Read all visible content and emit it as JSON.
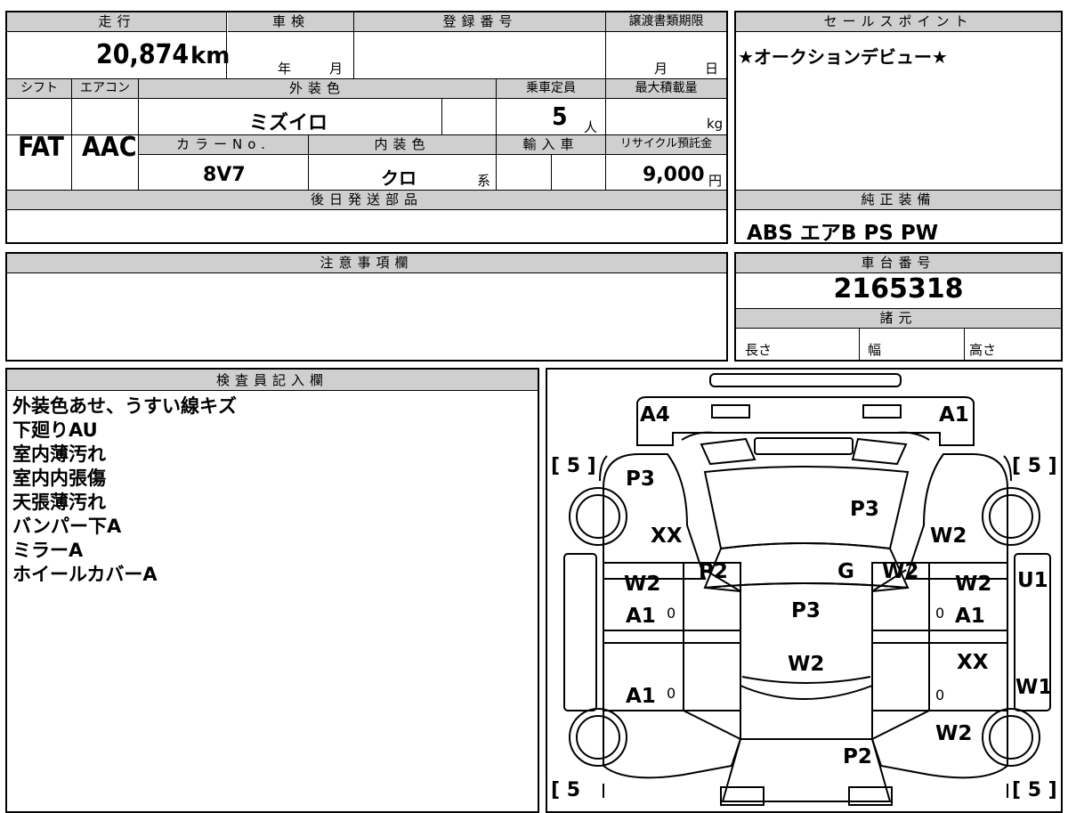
{
  "top_info": {
    "headers": {
      "mileage": "走行",
      "inspection": "車検",
      "registration_no": "登録番号",
      "transfer_deadline": "譲渡書類期限",
      "shift": "シフト",
      "aircon": "エアコン",
      "exterior_color": "外装色",
      "capacity": "乗車定員",
      "max_load": "最大積載量",
      "color_no": "カラーNo.",
      "interior_color": "内装色",
      "import": "輸入車",
      "recycle_fee": "リサイクル預託金",
      "later_parts": "後日発送部品"
    },
    "mileage_value": "20,874",
    "mileage_unit": "km",
    "inspection_year_unit": "年",
    "inspection_month_unit": "月",
    "transfer_month_unit": "月",
    "transfer_day_unit": "日",
    "shift_value": "FAT",
    "aircon_value": "AAC",
    "exterior_color_value": "ミズイロ",
    "capacity_value": "5",
    "capacity_unit": "人",
    "max_load_unit": "kg",
    "color_no_value": "8V7",
    "interior_color_value": "クロ",
    "interior_color_suffix": "系",
    "recycle_fee_value": "9,000",
    "recycle_fee_unit": "円"
  },
  "sales_point": {
    "header": "セールスポイント",
    "text": "★オークションデビュー★"
  },
  "equipment": {
    "header": "純正装備",
    "text": "ABS エアB PS PW"
  },
  "caution": {
    "header": "注意事項欄"
  },
  "chassis": {
    "header": "車台番号",
    "value": "2165318",
    "specs_header": "諸元",
    "length_label": "長さ",
    "width_label": "幅",
    "height_label": "高さ"
  },
  "inspector": {
    "header": "検査員記入欄",
    "lines": [
      "外装色あせ、うすい線キズ",
      "下廻りAU",
      "室内薄汚れ",
      "室内内張傷",
      "天張薄汚れ",
      "バンパー下A",
      "ミラーA",
      "ホイールカバーA"
    ]
  },
  "diagram": {
    "tire_top_left": "[ 5 ]",
    "tire_top_right": "[ 5 ]",
    "tire_bottom_left": "[ 5",
    "tire_bottom_right": "[ 5 ]",
    "marks": {
      "a4": "A4",
      "a1_top": "A1",
      "p3_left": "P3",
      "p3_hood": "P3",
      "xx_left": "XX",
      "w2_right_fender": "W2",
      "p2_left": "P2",
      "g": "G",
      "w2_mid": "W2",
      "w2_left_door": "W2",
      "a1_left_door": "A1",
      "p3_roof": "P3",
      "w2_right_door": "W2",
      "a1_right_door": "A1",
      "u1": "U1",
      "w2_roof": "W2",
      "a1_left_rear": "A1",
      "xx_right": "XX",
      "w1": "W1",
      "w2_right_rear": "W2",
      "p2_rear": "P2"
    },
    "zeros": [
      "0",
      "0",
      "0",
      "0"
    ]
  }
}
